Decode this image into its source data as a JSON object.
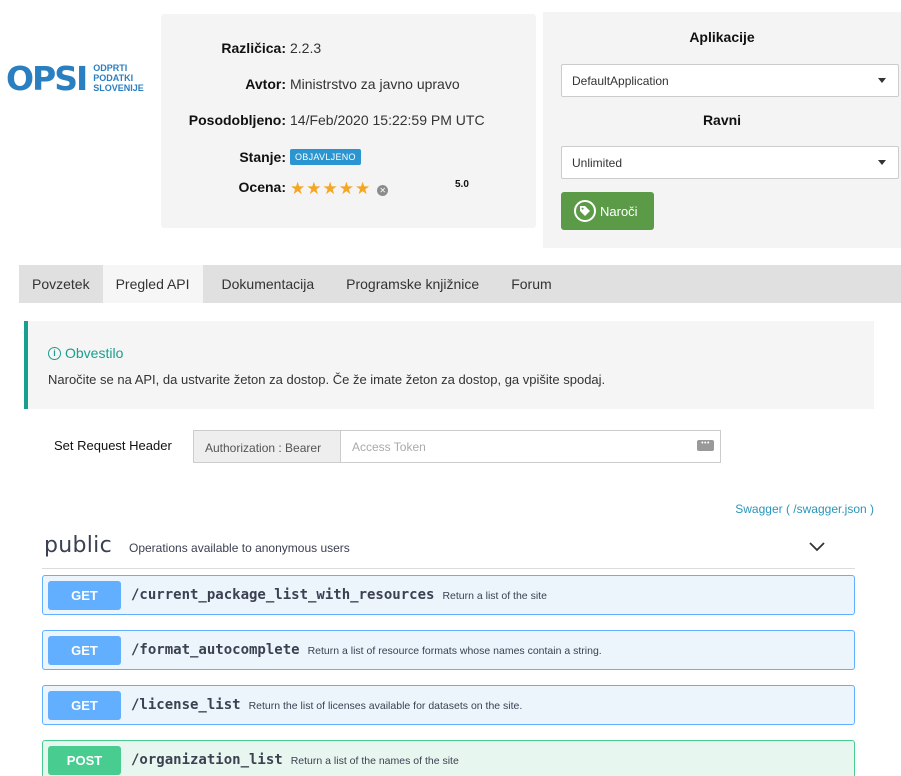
{
  "logo": {
    "mark": "OPSI",
    "lines": [
      "ODPRTI",
      "PODATKI",
      "SLOVENIJE"
    ]
  },
  "info": {
    "version_label": "Različica:",
    "version": "2.2.3",
    "author_label": "Avtor:",
    "author": "Ministrstvo za javno upravo",
    "updated_label": "Posodobljeno:",
    "updated": "14/Feb/2020 15:22:59 PM UTC",
    "status_label": "Stanje:",
    "status": "OBJAVLJENO",
    "rating_label": "Ocena:",
    "stars": "★★★★★",
    "rating": "5.0"
  },
  "subscribe": {
    "apps_title": "Aplikacije",
    "app_selected": "DefaultApplication",
    "tiers_title": "Ravni",
    "tier_selected": "Unlimited",
    "button_label": "Naroči"
  },
  "tabs": [
    {
      "label": "Povzetek"
    },
    {
      "label": "Pregled API"
    },
    {
      "label": "Dokumentacija"
    },
    {
      "label": "Programske knjižnice"
    },
    {
      "label": "Forum"
    }
  ],
  "notice": {
    "title": "Obvestilo",
    "text": "Naročite se na API, da ustvarite žeton za dostop. Če že imate žeton za dostop, ga vpišite spodaj."
  },
  "header": {
    "label": "Set Request Header",
    "prefix": "Authorization : Bearer",
    "placeholder": "Access Token"
  },
  "swagger_link": "Swagger ( /swagger.json )",
  "section": {
    "name": "public",
    "description": "Operations available to anonymous users"
  },
  "operations": [
    {
      "method": "GET",
      "path": "/current_package_list_with_resources",
      "summary": "Return a list of the site"
    },
    {
      "method": "GET",
      "path": "/format_autocomplete",
      "summary": "Return a list of resource formats whose names contain a string."
    },
    {
      "method": "GET",
      "path": "/license_list",
      "summary": "Return the list of licenses available for datasets on the site."
    },
    {
      "method": "POST",
      "path": "/organization_list",
      "summary": "Return a list of the names of the site"
    }
  ],
  "colors": {
    "get": "#61affe",
    "post": "#49cc90",
    "notice_accent": "#1a9e8e",
    "subscribe_button": "#5b9b48",
    "star": "#f5a623"
  }
}
